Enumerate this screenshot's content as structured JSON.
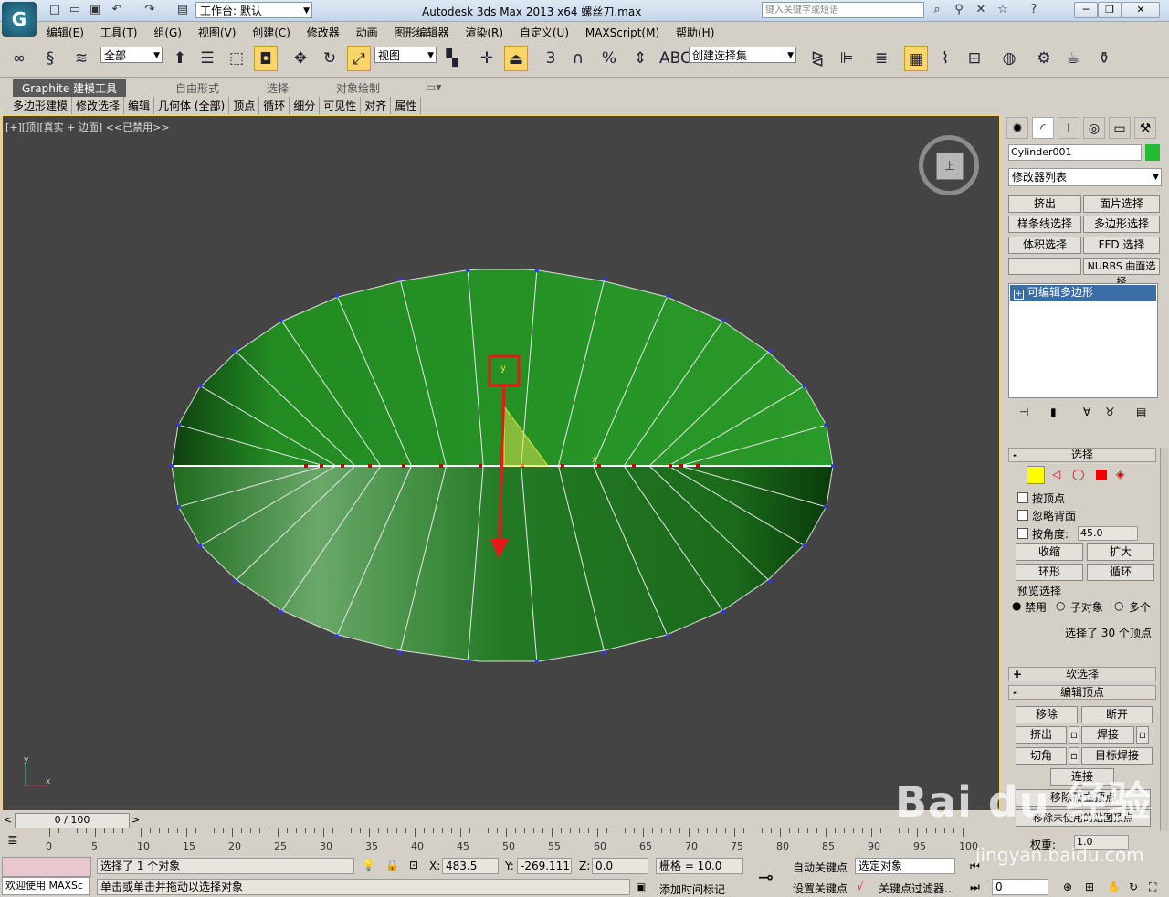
{
  "titlebar": {
    "app_title": "Autodesk 3ds Max  2013 x64      螺丝刀.max",
    "workspace_label": "工作台: 默认",
    "search_placeholder": "键入关键字或短语"
  },
  "menu": [
    "编辑(E)",
    "工具(T)",
    "组(G)",
    "视图(V)",
    "创建(C)",
    "修改器",
    "动画",
    "图形编辑器",
    "渲染(R)",
    "自定义(U)",
    "MAXScript(M)",
    "帮助(H)"
  ],
  "toolbar": {
    "selection_filter": "全部",
    "ref_coord": "视图",
    "named_selection": "创建选择集",
    "snap_label": "3",
    "angle_snap_label": "%"
  },
  "ribbon": {
    "tabs": [
      "Graphite 建模工具",
      "自由形式",
      "选择",
      "对象绘制"
    ],
    "subitems": [
      "多边形建模",
      "修改选择",
      "编辑",
      "几何体 (全部)",
      "顶点",
      "循环",
      "细分",
      "可见性",
      "对齐",
      "属性"
    ]
  },
  "viewport": {
    "label": "[+][顶][真实 + 边面]  <<已禁用>>",
    "viewcube_face": "上",
    "axis_y": "y",
    "axis_x": "x",
    "gizmo_y": "y",
    "gizmo_x": "x",
    "mesh_color": "#2e8b2e",
    "selected_vertex_color": "#cc0000",
    "vertex_color": "#3333ff"
  },
  "command_panel": {
    "object_name": "Cylinder001",
    "object_color": "#22bb33",
    "modifier_list": "修改器列表",
    "modifier_buttons": [
      "挤出",
      "面片选择",
      "样条线选择",
      "多边形选择",
      "体积选择",
      "FFD 选择",
      "",
      "NURBS 曲面选择"
    ],
    "stack_item": "可编辑多边形",
    "selection": {
      "header": "选择",
      "by_vertex": "按顶点",
      "ignore_backfacing": "忽略背面",
      "by_angle": "按角度:",
      "angle_value": "45.0",
      "shrink": "收缩",
      "grow": "扩大",
      "ring": "环形",
      "loop": "循环",
      "preview": "预览选择",
      "disabled": "禁用",
      "subobject": "子对象",
      "multi": "多个",
      "status": "选择了 30 个顶点"
    },
    "soft_selection": "软选择",
    "edit_vertices": {
      "header": "编辑顶点",
      "remove": "移除",
      "break": "断开",
      "extrude": "挤出",
      "weld": "焊接",
      "chamfer": "切角",
      "target_weld": "目标焊接",
      "connect": "连接",
      "remove_isolated": "移除孤立顶点",
      "remove_unused_map": "移除未使用的贴图顶点",
      "weight_label": "权重:",
      "weight_value": "1.0"
    }
  },
  "timeline": {
    "frame_display": "0 / 100",
    "ticks": [
      "0",
      "5",
      "10",
      "15",
      "20",
      "25",
      "30",
      "35",
      "40",
      "45",
      "50",
      "55",
      "60",
      "65",
      "70",
      "75",
      "80",
      "85",
      "90",
      "95",
      "100"
    ]
  },
  "status": {
    "selection_count": "选择了 1 个对象",
    "prompt": "单击或单击并拖动以选择对象",
    "welcome": "欢迎使用 MAXSc",
    "x_label": "X:",
    "x_value": "483.5",
    "y_label": "Y:",
    "y_value": "-269.111",
    "z_label": "Z:",
    "z_value": "0.0",
    "grid": "栅格 = 10.0",
    "add_time_tag": "添加时间标记",
    "auto_key": "自动关键点",
    "set_key": "设置关键点",
    "key_mode": "选定对象",
    "key_filters": "关键点过滤器...",
    "frame_value": "0"
  },
  "watermark": {
    "brand": "Bai du 经验",
    "url": "jingyan.baidu.com"
  }
}
